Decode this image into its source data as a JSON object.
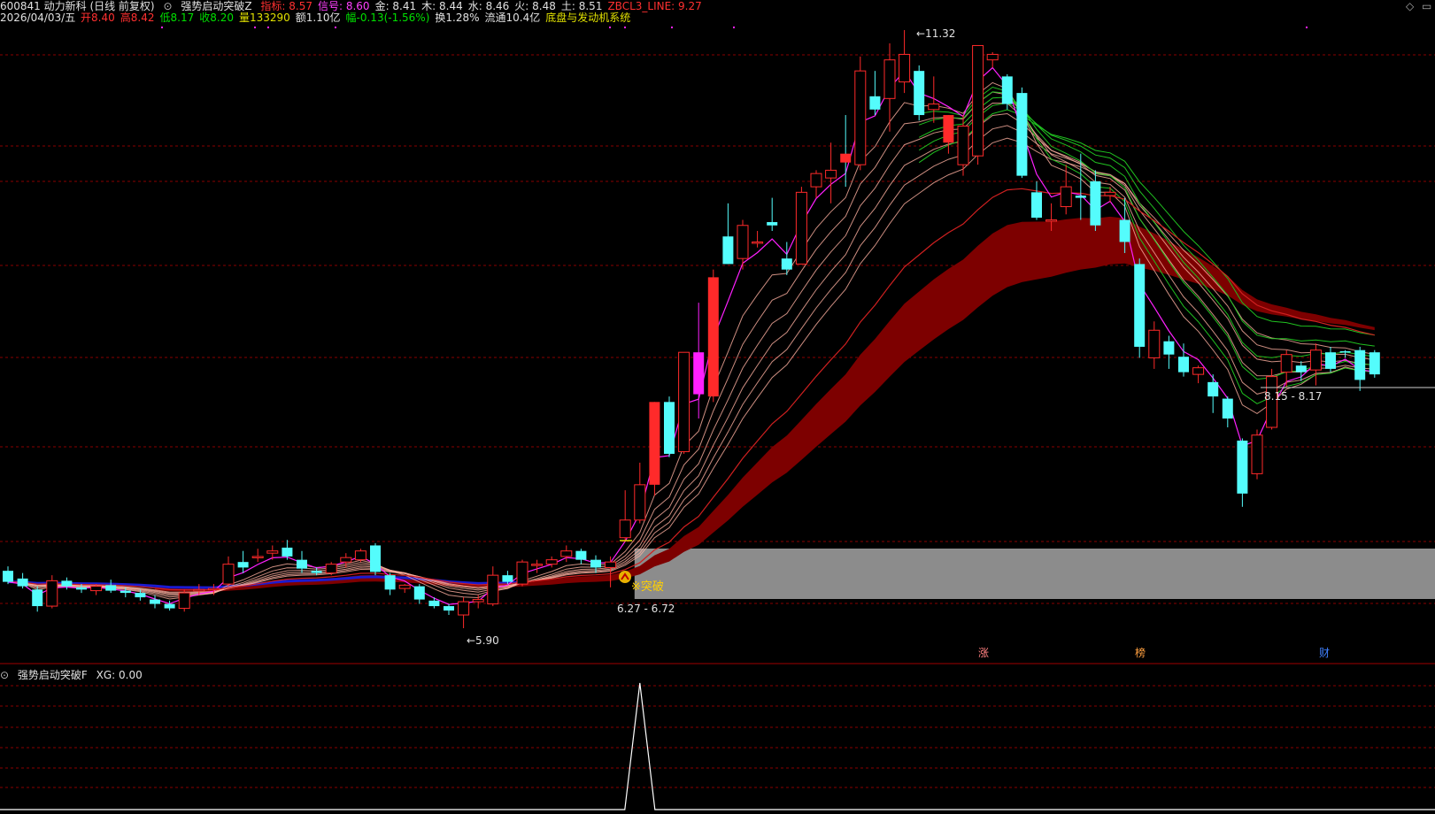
{
  "header": {
    "stock": "600841 动力新科 (日线 前复权)",
    "indicator_name": "强势启动突破Z",
    "values": [
      {
        "label": "指标: 8.57",
        "color": "#ff3030"
      },
      {
        "label": "信号: 8.60",
        "color": "#ff40ff"
      },
      {
        "label": "金: 8.41",
        "color": "#e0e0e0"
      },
      {
        "label": "木: 8.44",
        "color": "#e0e0e0"
      },
      {
        "label": "水: 8.46",
        "color": "#e0e0e0"
      },
      {
        "label": "火: 8.48",
        "color": "#e0e0e0"
      },
      {
        "label": "土: 8.51",
        "color": "#e0e0e0"
      },
      {
        "label": "ZBCL3_LINE: 9.27",
        "color": "#ff3030"
      }
    ],
    "date": "2026/04/03/五",
    "quote": [
      {
        "label": "开8.40",
        "color": "#ff3030"
      },
      {
        "label": "高8.42",
        "color": "#ff3030"
      },
      {
        "label": "低8.17",
        "color": "#00e000"
      },
      {
        "label": "收8.20",
        "color": "#00e000"
      },
      {
        "label": "量133290",
        "color": "#e0e000"
      },
      {
        "label": "额1.10亿",
        "color": "#e0e0e0"
      },
      {
        "label": "幅-0.13(-1.56%)",
        "color": "#00e000"
      },
      {
        "label": "换1.28%",
        "color": "#e0e0e0"
      },
      {
        "label": "流通10.4亿",
        "color": "#e0e0e0"
      },
      {
        "label": "底盘与发动机系统",
        "color": "#e0e000"
      }
    ],
    "sub_indicator": "强势启动突破F",
    "sub_value": "XG: 0.00"
  },
  "annotations": {
    "high_label": "11.32",
    "low_label": "5.90",
    "breakout_label": "※突破",
    "left_range_label": "6.27 - 6.72",
    "right_range_label": "8.15 - 8.17",
    "event_tags": [
      "涨",
      "榜",
      "财"
    ]
  },
  "colors": {
    "up": "#ff2a2a",
    "down": "#54fcfc",
    "grid": "#8a0000",
    "band": "#7d0000",
    "zone": "#8c8c8c",
    "ma_pink": "#ff20ff",
    "ma_red": "#d02020",
    "ma_blue": "#1b1bd0"
  },
  "chart_data": {
    "type": "candlestick",
    "ylim": [
      5.5,
      11.8
    ],
    "x": [
      1,
      2,
      3,
      4,
      5,
      6,
      7,
      8,
      9,
      10,
      11,
      12,
      13,
      14,
      15,
      16,
      17,
      18,
      19,
      20,
      21,
      22,
      23,
      24,
      25,
      26,
      27,
      28,
      29,
      30,
      31,
      32,
      33,
      34,
      35,
      36,
      37,
      38,
      39,
      40,
      41,
      42,
      43,
      44,
      45,
      46,
      47,
      48,
      49,
      50,
      51,
      52,
      53,
      54,
      55,
      56,
      57,
      58,
      59,
      60,
      61,
      62,
      63,
      64,
      65,
      66,
      67,
      68,
      69,
      70,
      71,
      72,
      73,
      74,
      75,
      76,
      77,
      78,
      79,
      80,
      81,
      82,
      83,
      84,
      85,
      86,
      87,
      88,
      89,
      90,
      91,
      92
    ],
    "ohlc": [
      [
        6.42,
        6.46,
        6.3,
        6.32
      ],
      [
        6.35,
        6.4,
        6.26,
        6.28
      ],
      [
        6.25,
        6.28,
        6.05,
        6.1
      ],
      [
        6.1,
        6.38,
        6.08,
        6.33
      ],
      [
        6.33,
        6.36,
        6.25,
        6.28
      ],
      [
        6.27,
        6.3,
        6.22,
        6.25
      ],
      [
        6.24,
        6.3,
        6.2,
        6.28
      ],
      [
        6.29,
        6.34,
        6.22,
        6.24
      ],
      [
        6.24,
        6.27,
        6.18,
        6.22
      ],
      [
        6.22,
        6.25,
        6.15,
        6.18
      ],
      [
        6.16,
        6.2,
        6.08,
        6.12
      ],
      [
        6.12,
        6.15,
        6.06,
        6.08
      ],
      [
        6.08,
        6.25,
        6.05,
        6.22
      ],
      [
        6.24,
        6.3,
        6.2,
        6.25
      ],
      [
        6.25,
        6.3,
        6.2,
        6.26
      ],
      [
        6.3,
        6.55,
        6.28,
        6.48
      ],
      [
        6.5,
        6.6,
        6.4,
        6.45
      ],
      [
        6.55,
        6.62,
        6.5,
        6.55
      ],
      [
        6.58,
        6.65,
        6.52,
        6.6
      ],
      [
        6.63,
        6.7,
        6.52,
        6.55
      ],
      [
        6.52,
        6.6,
        6.4,
        6.44
      ],
      [
        6.42,
        6.45,
        6.38,
        6.4
      ],
      [
        6.4,
        6.5,
        6.38,
        6.48
      ],
      [
        6.5,
        6.58,
        6.45,
        6.54
      ],
      [
        6.52,
        6.62,
        6.5,
        6.6
      ],
      [
        6.65,
        6.67,
        6.38,
        6.41
      ],
      [
        6.38,
        6.4,
        6.2,
        6.25
      ],
      [
        6.26,
        6.3,
        6.22,
        6.29
      ],
      [
        6.28,
        6.3,
        6.12,
        6.16
      ],
      [
        6.15,
        6.18,
        6.08,
        6.1
      ],
      [
        6.1,
        6.12,
        6.02,
        6.06
      ],
      [
        6.02,
        6.18,
        5.9,
        6.14
      ],
      [
        6.14,
        6.2,
        6.08,
        6.16
      ],
      [
        6.12,
        6.46,
        6.1,
        6.38
      ],
      [
        6.38,
        6.42,
        6.3,
        6.32
      ],
      [
        6.3,
        6.52,
        6.28,
        6.5
      ],
      [
        6.48,
        6.52,
        6.4,
        6.48
      ],
      [
        6.48,
        6.55,
        6.45,
        6.52
      ],
      [
        6.55,
        6.65,
        6.5,
        6.6
      ],
      [
        6.6,
        6.62,
        6.48,
        6.52
      ],
      [
        6.52,
        6.56,
        6.4,
        6.45
      ],
      [
        6.45,
        6.55,
        6.27,
        6.5
      ],
      [
        6.72,
        7.15,
        6.68,
        6.88
      ],
      [
        6.88,
        7.4,
        6.85,
        7.2
      ],
      [
        7.2,
        7.95,
        7.1,
        7.95
      ],
      [
        7.95,
        8.0,
        7.45,
        7.48
      ],
      [
        7.5,
        8.4,
        7.48,
        8.4
      ],
      [
        8.4,
        8.85,
        7.8,
        8.02
      ],
      [
        8.0,
        9.15,
        7.95,
        9.08
      ],
      [
        9.45,
        9.75,
        9.2,
        9.2
      ],
      [
        9.25,
        9.6,
        9.15,
        9.55
      ],
      [
        9.4,
        9.5,
        9.35,
        9.4
      ],
      [
        9.58,
        9.8,
        9.5,
        9.55
      ],
      [
        9.25,
        9.4,
        9.1,
        9.15
      ],
      [
        9.2,
        9.9,
        9.2,
        9.85
      ],
      [
        9.9,
        10.05,
        9.8,
        10.02
      ],
      [
        9.98,
        10.3,
        9.75,
        10.05
      ],
      [
        10.2,
        10.55,
        9.9,
        10.12
      ],
      [
        10.1,
        11.08,
        10.05,
        10.95
      ],
      [
        10.72,
        10.95,
        10.55,
        10.6
      ],
      [
        10.7,
        11.2,
        10.4,
        11.05
      ],
      [
        10.85,
        11.32,
        10.75,
        11.1
      ],
      [
        10.95,
        11.0,
        10.5,
        10.55
      ],
      [
        10.6,
        10.9,
        10.48,
        10.65
      ],
      [
        10.3,
        10.55,
        10.2,
        10.55
      ],
      [
        10.1,
        10.55,
        10.0,
        10.45
      ],
      [
        10.18,
        11.18,
        10.1,
        11.18
      ],
      [
        11.05,
        11.12,
        10.98,
        11.1
      ],
      [
        10.9,
        10.92,
        10.6,
        10.65
      ],
      [
        10.75,
        10.8,
        9.98,
        10.0
      ],
      [
        9.85,
        9.95,
        9.6,
        9.62
      ],
      [
        9.6,
        9.75,
        9.5,
        9.6
      ],
      [
        9.72,
        10.1,
        9.65,
        9.9
      ],
      [
        9.82,
        10.2,
        9.6,
        9.8
      ],
      [
        9.95,
        10.05,
        9.5,
        9.55
      ],
      [
        9.82,
        9.9,
        9.76,
        9.85
      ],
      [
        9.6,
        9.8,
        9.3,
        9.4
      ],
      [
        9.2,
        9.25,
        8.35,
        8.45
      ],
      [
        8.35,
        8.68,
        8.25,
        8.6
      ],
      [
        8.5,
        8.55,
        8.25,
        8.38
      ],
      [
        8.36,
        8.48,
        8.18,
        8.22
      ],
      [
        8.2,
        8.28,
        8.12,
        8.26
      ],
      [
        8.13,
        8.2,
        7.85,
        8.0
      ],
      [
        7.98,
        8.0,
        7.72,
        7.8
      ],
      [
        7.6,
        7.62,
        7.0,
        7.12
      ],
      [
        7.3,
        7.7,
        7.25,
        7.65
      ],
      [
        7.72,
        8.25,
        7.7,
        8.18
      ],
      [
        8.22,
        8.42,
        8.08,
        8.38
      ],
      [
        8.28,
        8.32,
        8.14,
        8.22
      ],
      [
        8.24,
        8.48,
        8.1,
        8.42
      ],
      [
        8.4,
        8.45,
        8.22,
        8.25
      ],
      [
        8.41,
        8.42,
        8.35,
        8.4
      ],
      [
        8.42,
        8.45,
        8.05,
        8.15
      ],
      [
        8.4,
        8.42,
        8.17,
        8.2
      ]
    ],
    "xg_signal": {
      "index": 43,
      "value": 1
    },
    "breakout_index": 43
  }
}
